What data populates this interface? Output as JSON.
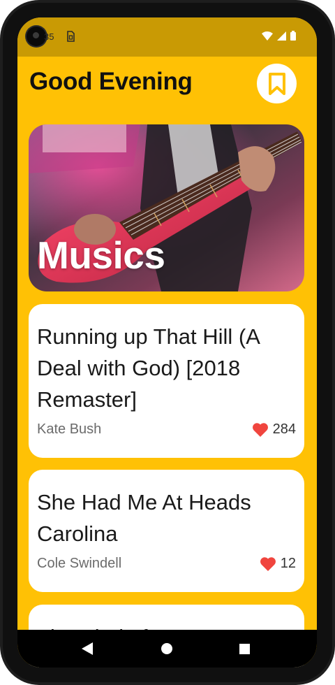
{
  "status_bar": {
    "time": "35",
    "icons": [
      "wifi-icon",
      "signal-icon",
      "battery-icon"
    ]
  },
  "header": {
    "title": "Good Evening",
    "bookmark_icon": "bookmark-icon"
  },
  "hero": {
    "label": "Musics"
  },
  "songs": [
    {
      "title": "Running up That Hill (A Deal with God) [2018 Remaster]",
      "artist": "Kate Bush",
      "likes": "284"
    },
    {
      "title": "She Had Me At Heads Carolina",
      "artist": "Cole Swindell",
      "likes": "12"
    },
    {
      "title": "The Kind of Love We Make",
      "artist": "",
      "likes": ""
    }
  ],
  "nav": {
    "back_icon": "back-triangle-icon",
    "home_icon": "home-circle-icon",
    "recents_icon": "recents-square-icon"
  },
  "colors": {
    "background": "#FFC105",
    "status_bar": "#C99A04",
    "bookmark": "#FFC105",
    "heart": "#F0453E"
  }
}
